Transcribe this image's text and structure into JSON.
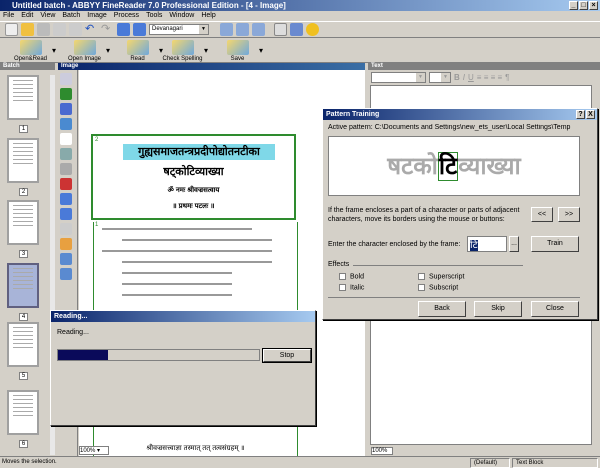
{
  "window": {
    "title": "Untitled batch - ABBYY FineReader 7.0 Professional Edition - [4 - Image]"
  },
  "menu": [
    "File",
    "Edit",
    "View",
    "Batch",
    "Image",
    "Process",
    "Tools",
    "Window",
    "Help"
  ],
  "toolbar": {
    "language": "Devanagari"
  },
  "main_toolbar": [
    {
      "label": "Open&Read"
    },
    {
      "label": "Open Image"
    },
    {
      "label": "Read"
    },
    {
      "label": "Check Spelling"
    },
    {
      "label": "Save"
    }
  ],
  "panels": {
    "batch": "Batch",
    "image": "Image",
    "text": "Text"
  },
  "thumbnails": [
    "1",
    "2",
    "3",
    "4",
    "5",
    "6"
  ],
  "selected_page": "4",
  "page": {
    "title": "गुह्यसमाजतन्त्रप्रदीपोद्योतनटीका",
    "subtitle": "षट्कोटिव्याख्या",
    "line1": "ॐ नमः श्रीवज्रसत्वाय",
    "line2": "॥ प्रथमः पटलः ॥",
    "block_num1": "2",
    "block_num2": "1",
    "last_line": "श्रीवज्रसत्त्वाज्ञा तस्मात् तत् तत्वसंग्रहम् ॥"
  },
  "zoom": {
    "image": "100%",
    "text": "100%"
  },
  "pattern_dialog": {
    "title": "Pattern Training",
    "help": "?",
    "close": "X",
    "active_label": "Active pattern:",
    "active_path": "C:\\Documents and Settings\\new_ets_user\\Local Settings\\Temp",
    "pattern_text_before": "षटको",
    "pattern_char": "टि",
    "pattern_text_after": "व्याख्या",
    "hint": "If the frame encloses a part of a character or parts of adjacent characters, move its borders using the mouse or buttons:",
    "prev_btn": "<<",
    "next_btn": ">>",
    "enter_label": "Enter the character enclosed by the frame:",
    "char_value": "टि",
    "browse": "...",
    "train": "Train",
    "effects": "Effects",
    "bold": "Bold",
    "italic": "Italic",
    "superscript": "Superscript",
    "subscript": "Subscript",
    "back": "Back",
    "skip": "Skip",
    "close_btn": "Close"
  },
  "reading_dialog": {
    "title": "Reading...",
    "status": "Reading...",
    "progress_percent": 25,
    "stop": "Stop"
  },
  "status": {
    "message": "Moves the selection.",
    "style": "(Default)",
    "block": "Text Block"
  },
  "colors": {
    "title_active": "#0a246a",
    "progress": "#0a0a5a",
    "highlight": "#7fd8e8",
    "frame": "#2e8b2e"
  }
}
